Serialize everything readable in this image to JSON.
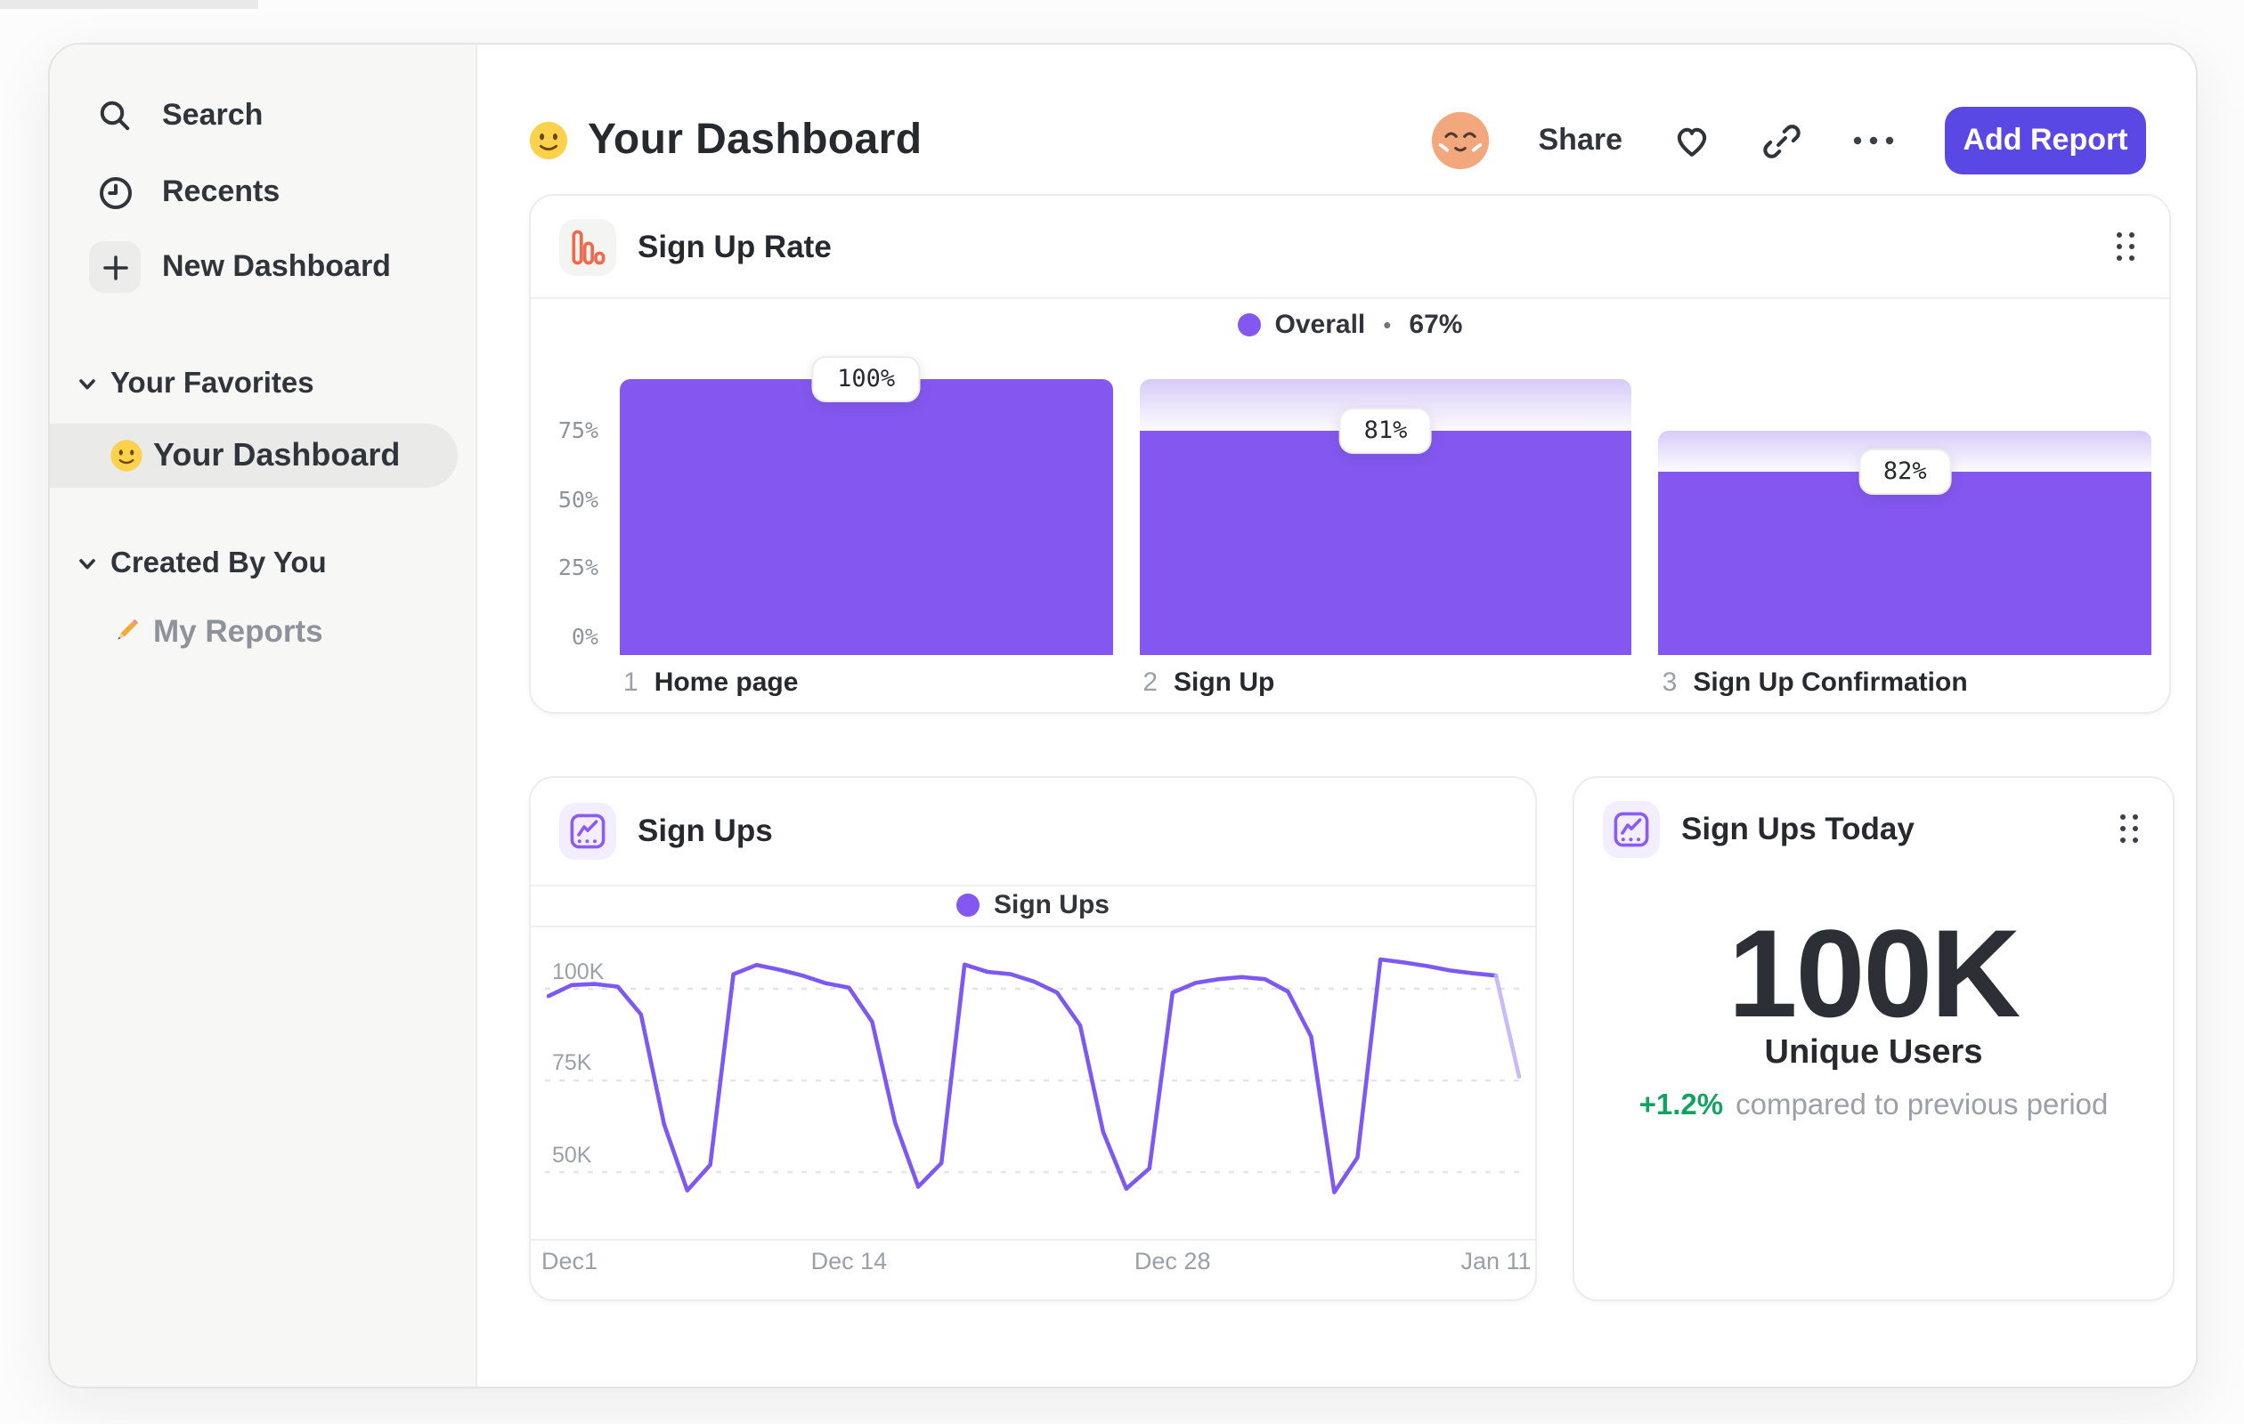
{
  "colors": {
    "accent_purple": "#8458f0",
    "line_purple": "#7d58f2",
    "line_faded": "#c3b4f7",
    "button_purple": "#5a48e4",
    "funnel_icon_orange": "#ee6a4d",
    "chart_icon_purple": "#8a5cf5",
    "positive_green": "#13a262",
    "sidebar_bg": "#f7f7f5",
    "selected_pill_bg": "#eaeae8"
  },
  "sidebar": {
    "items": [
      {
        "id": "search",
        "label": "Search"
      },
      {
        "id": "recents",
        "label": "Recents"
      },
      {
        "id": "new-dashboard",
        "label": "New Dashboard"
      }
    ],
    "sections": [
      {
        "title": "Your Favorites",
        "items": [
          {
            "emoji": "smiley",
            "label": "Your Dashboard",
            "selected": true
          }
        ]
      },
      {
        "title": "Created By You",
        "items": [
          {
            "emoji": "pencil",
            "label": "My Reports",
            "selected": false
          }
        ]
      }
    ]
  },
  "header": {
    "title": "Your Dashboard",
    "share_label": "Share",
    "add_report_label": "Add Report"
  },
  "cards": {
    "funnel": {
      "title": "Sign Up Rate",
      "legend": {
        "label": "Overall",
        "separator": "•",
        "value": "67%"
      },
      "chart_data": {
        "type": "bar",
        "subtype": "funnel",
        "title": "Sign Up Rate",
        "overall_conversion": "67%",
        "ylim": [
          0,
          100
        ],
        "yticks": [
          {
            "label": "75%",
            "value": 75
          },
          {
            "label": "50%",
            "value": 50
          },
          {
            "label": "25%",
            "value": 25
          },
          {
            "label": "0%",
            "value": 0
          }
        ],
        "steps": [
          {
            "num": "1",
            "label": "Home page",
            "conversion_label": "100%",
            "solid_pct": 100,
            "light_pct": 100
          },
          {
            "num": "2",
            "label": "Sign Up",
            "conversion_label": "81%",
            "solid_pct": 81,
            "light_pct": 100
          },
          {
            "num": "3",
            "label": "Sign Up Confirmation",
            "conversion_label": "82%",
            "solid_pct": 66.4,
            "light_pct": 81
          }
        ]
      }
    },
    "line": {
      "title": "Sign Ups",
      "legend": {
        "label": "Sign Ups"
      },
      "chart_data": {
        "type": "line",
        "title": "Sign Ups",
        "unit": "K users",
        "series": [
          {
            "name": "Sign Ups",
            "values": [
              98,
              101,
              101.3,
              100.6,
              93,
              63,
              45,
              52,
              104,
              106.5,
              105.2,
              103.6,
              101.5,
              100.3,
              91,
              63.5,
              46,
              52.5,
              106.6,
              104.6,
              104,
              102,
              99,
              90,
              61,
              45.5,
              51,
              99,
              101.6,
              102.6,
              103.2,
              102.6,
              99.2,
              87,
              44.5,
              54,
              108,
              107.2,
              106.2,
              105,
              104.2,
              103.6,
              76
            ]
          }
        ],
        "faded_from_index": 41,
        "yticks": [
          {
            "label": "100K",
            "value": 100
          },
          {
            "label": "75K",
            "value": 75
          },
          {
            "label": "50K",
            "value": 50
          }
        ],
        "xticks": [
          {
            "label": "Dec1",
            "index": 0
          },
          {
            "label": "Dec 14",
            "index": 13
          },
          {
            "label": "Dec 28",
            "index": 27
          },
          {
            "label": "Jan 11",
            "index": 41
          }
        ],
        "grid": "dashed-horizontal",
        "legend_position": "top-center"
      }
    },
    "metric": {
      "title": "Sign Ups Today",
      "chart_data": {
        "type": "metric",
        "value": "100K",
        "value_label": "Unique Users",
        "delta": "+1.2%",
        "delta_note": "compared to previous period"
      }
    }
  }
}
